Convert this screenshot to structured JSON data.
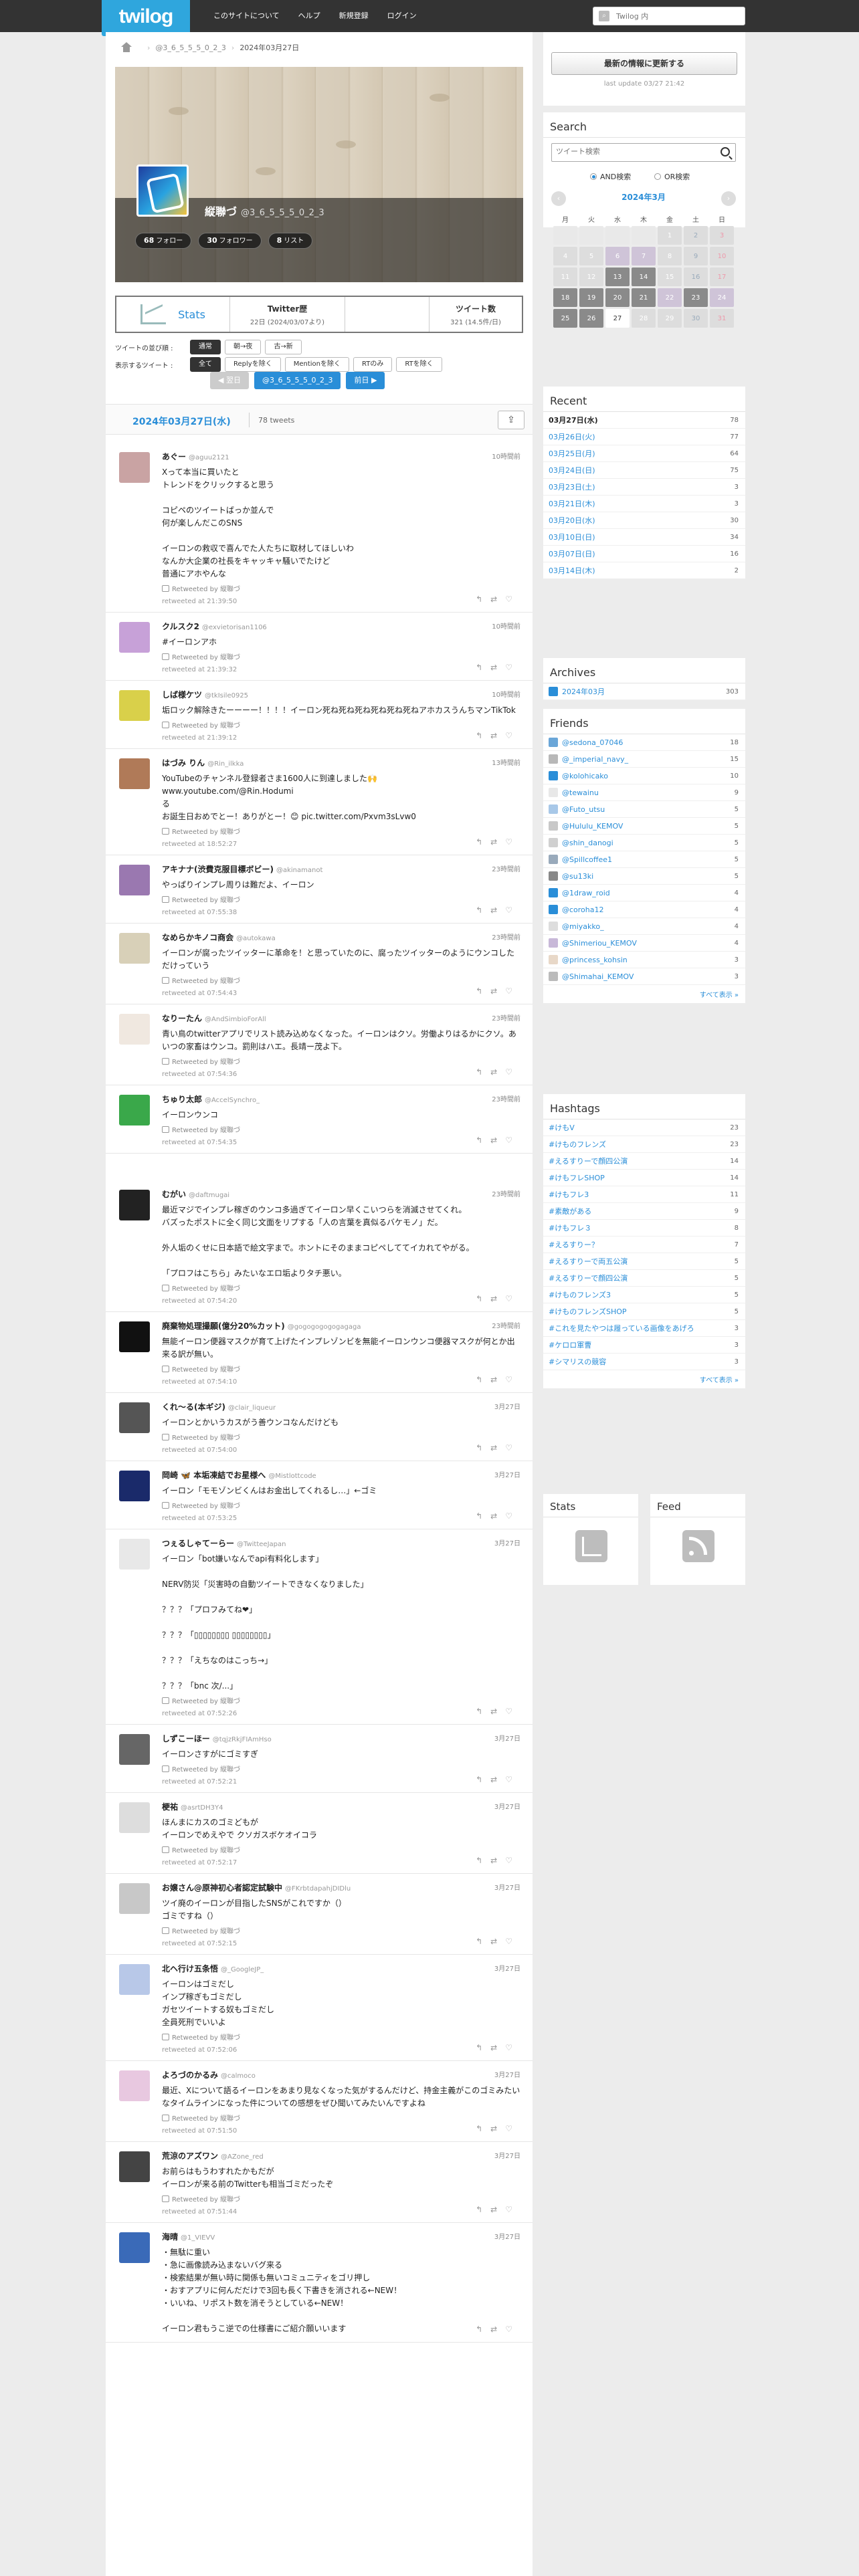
{
  "brand": {
    "logo": "twilog"
  },
  "nav": [
    "このサイトについて",
    "ヘルプ",
    "新規登録",
    "ログイン"
  ],
  "top_search": {
    "placeholder": "Twilog 内"
  },
  "breadcrumb": {
    "user": "@3_6_5_5_5_0_2_3",
    "date": "2024年03月27日"
  },
  "profile": {
    "name": "縦聯づ",
    "screen_name": "@3_6_5_5_5_0_2_3",
    "follow": "68",
    "follow_label": "フォロー",
    "follower": "30",
    "follower_label": "フォロワー",
    "lists": "8",
    "lists_label": "リスト"
  },
  "stats": {
    "stats_label": "Stats",
    "twitter_label": "Twitter歴",
    "twitter_value": "22日 (2024/03/07より)",
    "tweet_label": "ツイート数",
    "tweet_value": "321 (14.5件/日)"
  },
  "order": {
    "label": "ツイートの並び順 :",
    "options": [
      "通常",
      "朝→夜",
      "古→新"
    ]
  },
  "show": {
    "label": "表示するツイート :",
    "options": [
      "全て",
      "Replyを除く",
      "Mentionを除く",
      "RTのみ",
      "RTを除く"
    ]
  },
  "pager": {
    "prev": "◀ 翌日",
    "user": "@3_6_5_5_5_0_2_3",
    "next": "前日 ▶"
  },
  "day": {
    "date": "2024年03月27日(水)",
    "count": "78 tweets"
  },
  "tweets": [
    {
      "name": "あぐー",
      "handle": "@aguu2121",
      "time": "10時間前",
      "text": "Xって本当に買いたと\nトレンドをクリックすると思う\n\nコピペのツイートばっか並んで\n何が楽しんだこのSNS\n\nイーロンの救収で喜んでた人たちに取材してほしいわ\nなんか大企業の社長をキャッキャ騒いでたけど\n普通にアホやんな",
      "rt": "Retweeted by 縦聯づ",
      "at": "retweeted at 21:39:50"
    },
    {
      "name": "クルスク2",
      "handle": "@exvietorisan1106",
      "time": "10時間前",
      "text": "#イーロンアホ",
      "rt": "Retweeted by 縦聯づ",
      "at": "retweeted at 21:39:32"
    },
    {
      "name": "しば様ケツ",
      "handle": "@tkIsile0925",
      "time": "10時間前",
      "text": "垢ロック解除きたーーーー！！！！イーロン死ね死ね死ね死ね死ね死ねアホカスうんちマンTikTok",
      "rt": "Retweeted by 縦聯づ",
      "at": "retweeted at 21:39:12"
    },
    {
      "name": "はづみ りん",
      "handle": "@Rin_ilkka",
      "time": "13時間前",
      "text": "YouTubeのチャンネル登録者さま1600人に到達しました🙌\nwww.youtube.com/@Rin.Hodumi\nる\nお誕生日おめでとー！ありがとー！😊 pic.twitter.com/Pxvm3sLvw0",
      "rt": "Retweeted by 縦聯づ",
      "at": "retweeted at 18:52:27"
    },
    {
      "name": "アキナナ(渋費克服目標ボビー)",
      "handle": "@akinamanot",
      "time": "23時間前",
      "text": "やっぱりインプレ周りは難だよ、イーロン",
      "rt": "Retweeted by 縦聯づ",
      "at": "retweeted at 07:55:38"
    },
    {
      "name": "なめらかキノコ商会",
      "handle": "@autokawa",
      "time": "23時間前",
      "text": "イーロンが腐ったツイッターに革命を！と思っていたのに、腐ったツイッターのようにウンコしただけっていう",
      "rt": "Retweeted by 縦聯づ",
      "at": "retweeted at 07:54:43"
    },
    {
      "name": "なりーたん",
      "handle": "@AndSimbioForAll",
      "time": "23時間前",
      "text": "青い鳥のtwitterアプリでリスト読み込めなくなった。イーロンはクソ。労働よりはるかにクソ。あいつの家畜はウンコ。罰則はハエ。長靖ー茂よ下。",
      "rt": "Retweeted by 縦聯づ",
      "at": "retweeted at 07:54:36"
    },
    {
      "name": "ちゅり太郎",
      "handle": "@AccelSynchro_",
      "time": "23時間前",
      "text": "イーロンウンコ",
      "rt": "Retweeted by 縦聯づ",
      "at": "retweeted at 07:54:35"
    },
    {
      "name": "むがい",
      "handle": "@daftmugai",
      "time": "23時間前",
      "text": "最近マジでインプレ稼ぎのウンコ多過ぎてイーロン早くこいつらを消滅させてくれ。\nバズったポストに全く同じ文面をリプする「人の言葉を真似るバケモノ」だ。\n\n外人垢のくせに日本語で絵文字まで。ホントにそのままコピペしててイカれてやがる。\n\n「プロフはこちら」みたいなエロ垢よりタチ悪い。",
      "rt": "Retweeted by 縦聯づ",
      "at": "retweeted at 07:54:20"
    },
    {
      "name": "廃棄物処理撮願(億分20%カット)",
      "handle": "@gogogogogogagaga",
      "time": "23時間前",
      "text": "無能イーロン便器マスクが育て上げたインプレゾンビを無能イーロンウンコ便器マスクが何とか出来る訳が無い。",
      "rt": "Retweeted by 縦聯づ",
      "at": "retweeted at 07:54:10"
    },
    {
      "name": "くれ～る(本ギジ)",
      "handle": "@clair_liqueur",
      "time": "3月27日",
      "text": "イーロンとかいうカスがう善ウンコなんだけども",
      "rt": "Retweeted by 縦聯づ",
      "at": "retweeted at 07:54:00"
    },
    {
      "name": "岡崎 🦋 本垢凍結でお星様へ",
      "handle": "@Mistlottcode",
      "time": "3月27日",
      "text": "イーロン「モモゾンビくんはお金出してくれるし…」←ゴミ",
      "rt": "Retweeted by 縦聯づ",
      "at": "retweeted at 07:53:25"
    },
    {
      "name": "つぇるしゃてーらー",
      "handle": "@TwitteeJapan",
      "time": "3月27日",
      "text": "イーロン「bot嫌いなんでapi有料化します」\n\nNERV防災「災害時の自動ツイートできなくなりました」\n\n？？？「プロフみてね❤」\n\n？？？「▯▯▯▯▯▯▯▯ ▯▯▯▯▯▯▯▯」\n\n？？？「えちなのはこっち→」\n\n？？？「bnc 次/...」",
      "rt": "Retweeted by 縦聯づ",
      "at": "retweeted at 07:52:26"
    },
    {
      "name": "しずこーほー",
      "handle": "@tqjzRkjFIAmHso",
      "time": "3月27日",
      "text": "イーロンさすがにゴミすぎ",
      "rt": "Retweeted by 縦聯づ",
      "at": "retweeted at 07:52:21"
    },
    {
      "name": "梗祐",
      "handle": "@asrtDH3Y4",
      "time": "3月27日",
      "text": "ほんまにカスのゴミどもが\nイーロンでめえやで クソガスボケオイコラ",
      "rt": "Retweeted by 縦聯づ",
      "at": "retweeted at 07:52:17"
    },
    {
      "name": "お嬢さん@原神初心者認定試験中",
      "handle": "@FKrbtdapahjDIDlu",
      "time": "3月27日",
      "text": "ツイ廃のイーロンが目指したSNSがこれですか（）\nゴミですね（）",
      "rt": "Retweeted by 縦聯づ",
      "at": "retweeted at 07:52:15"
    },
    {
      "name": "北ヘ行け五条悟",
      "handle": "@_GoogleJP_",
      "time": "3月27日",
      "text": "イーロンはゴミだし\nインプ稼ぎもゴミだし\nガセツイートする奴もゴミだし\n全員死刑でいいよ",
      "rt": "Retweeted by 縦聯づ",
      "at": "retweeted at 07:52:06"
    },
    {
      "name": "よろづのかるみ",
      "handle": "@calmoco",
      "time": "3月27日",
      "text": "最近、Xについて語るイーロンをあまり見なくなった気がするんだけど、持金主義がこのゴミみたいなタイムラインになった件についての感想をぜひ聞いてみたいんですよね",
      "rt": "Retweeted by 縦聯づ",
      "at": "retweeted at 07:51:50"
    },
    {
      "name": "荒涼のアズワン",
      "handle": "@AZone_red",
      "time": "3月27日",
      "text": "お前らはもうわすれたかもだが\nイーロンが来る前のTwitterも相当ゴミだったぞ",
      "rt": "Retweeted by 縦聯づ",
      "at": "retweeted at 07:51:44"
    },
    {
      "name": "海晴",
      "handle": "@1_VIEVV",
      "time": "3月27日",
      "text": "・無駄に重い\n・急に画像読み込まないバグ来る\n・検索結果が無い時に関係も無いコミュニティをゴリ押し\n・おすアプリに何んだだけで3回も長く下書きを消される←NEW！\n・いいね、リポスト数を消そうとしている←NEW！\n\nイーロン君もうこ逆での仕様書にご紹介願いいます",
      "rt": "",
      "at": ""
    }
  ],
  "sidebar": {
    "update_button": "最新の情報に更新する",
    "last_update": "last update 03/27 21:42",
    "search_title": "Search",
    "search_placeholder": "ツイート検索",
    "and_label": "AND検索",
    "or_label": "OR検索",
    "calendar": {
      "month": "2024年3月",
      "weekdays": [
        "月",
        "火",
        "水",
        "木",
        "金",
        "土",
        "日"
      ],
      "weeks": [
        [
          "",
          "",
          "",
          "",
          "1",
          "2",
          "3"
        ],
        [
          "4",
          "5",
          "6",
          "7",
          "8",
          "9",
          "10"
        ],
        [
          "11",
          "12",
          "13",
          "14",
          "15",
          "16",
          "17"
        ],
        [
          "18",
          "19",
          "20",
          "21",
          "22",
          "23",
          "24"
        ],
        [
          "25",
          "26",
          "27",
          "28",
          "29",
          "30",
          "31"
        ]
      ]
    },
    "recent_title": "Recent",
    "recent": [
      {
        "d": "03月27日(水)",
        "n": "78"
      },
      {
        "d": "03月26日(火)",
        "n": "77"
      },
      {
        "d": "03月25日(月)",
        "n": "64"
      },
      {
        "d": "03月24日(日)",
        "n": "75"
      },
      {
        "d": "03月23日(土)",
        "n": "3"
      },
      {
        "d": "03月21日(木)",
        "n": "3"
      },
      {
        "d": "03月20日(水)",
        "n": "30"
      },
      {
        "d": "03月10日(日)",
        "n": "34"
      },
      {
        "d": "03月07日(日)",
        "n": "16"
      },
      {
        "d": "03月14日(木)",
        "n": "2"
      }
    ],
    "archives_title": "Archives",
    "archives": [
      {
        "d": "2024年03月",
        "n": "303"
      }
    ],
    "friends_title": "Friends",
    "friends": [
      {
        "d": "@sedona_07046",
        "n": "18"
      },
      {
        "d": "@_imperial_navy_",
        "n": "15"
      },
      {
        "d": "@kolohicako",
        "n": "10"
      },
      {
        "d": "@tewainu",
        "n": "9"
      },
      {
        "d": "@Futo_utsu",
        "n": "5"
      },
      {
        "d": "@Hululu_KEMOV",
        "n": "5"
      },
      {
        "d": "@shin_danogi",
        "n": "5"
      },
      {
        "d": "@Spillcoffee1",
        "n": "5"
      },
      {
        "d": "@su13ki",
        "n": "5"
      },
      {
        "d": "@1draw_roid",
        "n": "4"
      },
      {
        "d": "@coroha12",
        "n": "4"
      },
      {
        "d": "@miyakko_",
        "n": "4"
      },
      {
        "d": "@Shimeriou_KEMOV",
        "n": "4"
      },
      {
        "d": "@princess_kohsin",
        "n": "3"
      },
      {
        "d": "@Shimahai_KEMOV",
        "n": "3"
      }
    ],
    "friends_more": "すべて表示 »",
    "hashtags_title": "Hashtags",
    "hashtags": [
      {
        "d": "#けもV",
        "n": "23"
      },
      {
        "d": "#けものフレンズ",
        "n": "23"
      },
      {
        "d": "#えるすりーで顔四公演",
        "n": "14"
      },
      {
        "d": "#けもフレSHOP",
        "n": "14"
      },
      {
        "d": "#けもフレ3",
        "n": "11"
      },
      {
        "d": "#素敵がある",
        "n": "9"
      },
      {
        "d": "#けもフレ３",
        "n": "8"
      },
      {
        "d": "#えるすりー？",
        "n": "7"
      },
      {
        "d": "#えるすりーで両五公演",
        "n": "5"
      },
      {
        "d": "#えるすりーで顔四公演",
        "n": "5"
      },
      {
        "d": "#けものフレンズ3",
        "n": "5"
      },
      {
        "d": "#けものフレンズSHOP",
        "n": "5"
      },
      {
        "d": "#これを見たやつは履っている画像をあげろ",
        "n": "3"
      },
      {
        "d": "#ケロロ軍曹",
        "n": "3"
      },
      {
        "d": "#シマリスの競容",
        "n": "3"
      }
    ],
    "hashtags_more": "すべて表示 »",
    "stats_title": "Stats",
    "feed_title": "Feed"
  },
  "colors": {
    "accent": "#2a8ed8",
    "topbar": "#333333",
    "logo": "#2fa6dd"
  }
}
